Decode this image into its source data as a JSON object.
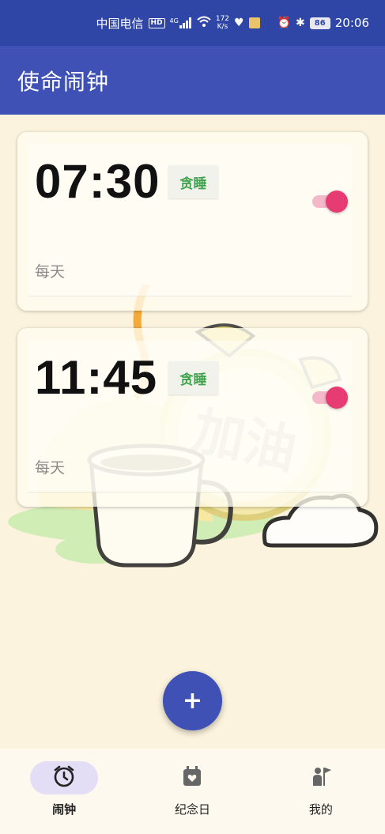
{
  "status_bar": {
    "carrier": "中国电信",
    "hd_badge": "HD",
    "network": "4G",
    "speed_value": "172",
    "speed_unit": "K/s",
    "battery": "86",
    "time": "20:06"
  },
  "app_bar": {
    "title": "使命闹钟"
  },
  "alarms": [
    {
      "time": "07:30",
      "snooze_label": "贪睡",
      "enabled": true,
      "repeat": "每天"
    },
    {
      "time": "11:45",
      "snooze_label": "贪睡",
      "enabled": true,
      "repeat": "每天"
    }
  ],
  "background": {
    "stamp_text": "加油"
  },
  "fab": {
    "label": "+"
  },
  "bottom_nav": {
    "items": [
      {
        "label": "闹钟",
        "icon": "alarm-clock-icon",
        "active": true
      },
      {
        "label": "纪念日",
        "icon": "calendar-heart-icon",
        "active": false
      },
      {
        "label": "我的",
        "icon": "person-flag-icon",
        "active": false
      }
    ]
  },
  "colors": {
    "status_bar": "#2f46a6",
    "app_bar": "#3f51b5",
    "background": "#fbf3dd",
    "snooze_text": "#3fa34d",
    "toggle_thumb": "#e63b73",
    "toggle_track": "#f3b9c8",
    "nav_active_pill": "#e3def5"
  }
}
